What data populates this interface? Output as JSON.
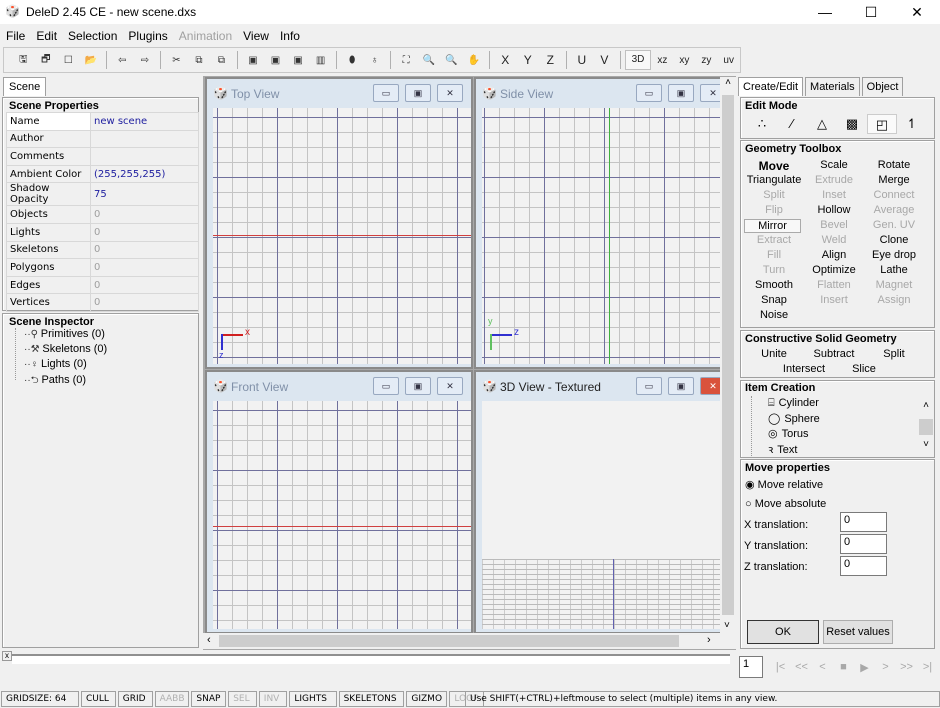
{
  "window": {
    "title": "DeleD 2.45 CE - new scene.dxs",
    "minimize": "—",
    "maximize": "☐",
    "close": "✕"
  },
  "menu": [
    "File",
    "Edit",
    "Selection",
    "Plugins",
    "Animation",
    "View",
    "Info"
  ],
  "menu_disabled": [
    "Animation"
  ],
  "toolbar": {
    "icons": [
      "save-icon",
      "save-all-icon",
      "new-icon",
      "open-icon",
      "undo-icon",
      "redo-icon",
      "cut-icon",
      "copy-icon",
      "paste-icon",
      "view1-icon",
      "view2-icon",
      "view3-icon",
      "view4-icon",
      "light-icon",
      "bulb-icon",
      "zoom-extents-icon",
      "zoom-out-icon",
      "zoom-in-icon",
      "pan-icon"
    ],
    "glyphs": [
      "🖫",
      "🗗",
      "☐",
      "📂",
      "⇦",
      "⇨",
      "✂",
      "⧉",
      "⧉",
      "▣",
      "▣",
      "▣",
      "▥",
      "⬮",
      "♁",
      "⛶",
      "🔍",
      "🔍",
      "✋"
    ],
    "axes": [
      "X",
      "Y",
      "Z",
      "U",
      "V"
    ],
    "views": [
      "3D",
      "xz",
      "xy",
      "zy",
      "uv"
    ],
    "active_view": "3D"
  },
  "left": {
    "tab": "Scene",
    "properties": {
      "title": "Scene Properties",
      "rows": [
        {
          "label": "Name",
          "value": "new scene"
        },
        {
          "label": "Author",
          "value": ""
        },
        {
          "label": "Comments",
          "value": ""
        },
        {
          "label": "Ambient Color",
          "value": "(255,255,255)"
        },
        {
          "label": "Shadow Opacity",
          "value": "75"
        },
        {
          "label": "Objects",
          "value": "0"
        },
        {
          "label": "Lights",
          "value": "0"
        },
        {
          "label": "Skeletons",
          "value": "0"
        },
        {
          "label": "Polygons",
          "value": "0"
        },
        {
          "label": "Edges",
          "value": "0"
        },
        {
          "label": "Vertices",
          "value": "0"
        }
      ]
    },
    "inspector": {
      "title": "Scene Inspector",
      "items": [
        "Primitives (0)",
        "Skeletons (0)",
        "Lights (0)",
        "Paths (0)"
      ]
    }
  },
  "views": [
    {
      "title": "Top View",
      "axis_h": "x",
      "axis_v": "z"
    },
    {
      "title": "Side View",
      "axis_h": "z",
      "axis_v": "y"
    },
    {
      "title": "Front View"
    },
    {
      "title": "3D View - Textured"
    }
  ],
  "right": {
    "tabs": [
      "Create/Edit",
      "Materials",
      "Object"
    ],
    "active_tab": "Create/Edit",
    "edit_mode": {
      "title": "Edit Mode",
      "icons": [
        "vertex-mode-icon",
        "edge-mode-icon",
        "polygon-mode-icon",
        "texture-mode-icon",
        "object-mode-icon",
        "skeleton-mode-icon"
      ],
      "glyphs": [
        "∴",
        "⁄",
        "△",
        "▩",
        "◰",
        "↿"
      ],
      "active": "object-mode-icon"
    },
    "geometry": {
      "title": "Geometry Toolbox",
      "tools": [
        {
          "l": "Move",
          "s": "b"
        },
        {
          "l": "Scale",
          "s": ""
        },
        {
          "l": "Rotate",
          "s": ""
        },
        {
          "l": "Triangulate",
          "s": ""
        },
        {
          "l": "Extrude",
          "s": "d"
        },
        {
          "l": "Merge",
          "s": ""
        },
        {
          "l": "Split",
          "s": "d"
        },
        {
          "l": "Inset",
          "s": "d"
        },
        {
          "l": "Connect",
          "s": "d"
        },
        {
          "l": "Flip",
          "s": "d"
        },
        {
          "l": "Hollow",
          "s": ""
        },
        {
          "l": "Average",
          "s": "d"
        },
        {
          "l": "Mirror",
          "s": "m"
        },
        {
          "l": "Bevel",
          "s": "d"
        },
        {
          "l": "Gen. UV",
          "s": "d"
        },
        {
          "l": "Extract",
          "s": "d"
        },
        {
          "l": "Weld",
          "s": "d"
        },
        {
          "l": "Clone",
          "s": ""
        },
        {
          "l": "Fill",
          "s": "d"
        },
        {
          "l": "Align",
          "s": ""
        },
        {
          "l": "Eye drop",
          "s": ""
        },
        {
          "l": "Turn",
          "s": "d"
        },
        {
          "l": "Optimize",
          "s": ""
        },
        {
          "l": "Lathe",
          "s": ""
        },
        {
          "l": "Smooth",
          "s": ""
        },
        {
          "l": "Flatten",
          "s": "d"
        },
        {
          "l": "Magnet",
          "s": "d"
        },
        {
          "l": "Snap",
          "s": ""
        },
        {
          "l": "Insert",
          "s": "d"
        },
        {
          "l": "Assign",
          "s": "d"
        },
        {
          "l": "Noise",
          "s": ""
        }
      ]
    },
    "csg": {
      "title": "Constructive Solid Geometry",
      "tools": [
        "Unite",
        "Subtract",
        "Split",
        "Intersect",
        "Slice"
      ]
    },
    "item_creation": {
      "title": "Item Creation",
      "items": [
        {
          "label": "Cylinder",
          "glyph": "⌸"
        },
        {
          "label": "Sphere",
          "glyph": "◯"
        },
        {
          "label": "Torus",
          "glyph": "◎"
        },
        {
          "label": "Text",
          "glyph": "ꝛ"
        }
      ]
    },
    "move": {
      "title": "Move properties",
      "relative": "Move relative",
      "absolute": "Move absolute",
      "selected": "relative",
      "fields": [
        {
          "label": "X translation:",
          "value": "0"
        },
        {
          "label": "Y translation:",
          "value": "0"
        },
        {
          "label": "Z translation:",
          "value": "0"
        }
      ],
      "ok": "OK",
      "reset": "Reset values"
    }
  },
  "timeline": {
    "frame": "1",
    "controls": [
      "|<",
      "<<",
      "<",
      "■",
      "▶",
      ">",
      ">>",
      ">|"
    ]
  },
  "status": {
    "gridsize": "GRIDSIZE: 64",
    "toggles": [
      {
        "l": "CULL",
        "on": true
      },
      {
        "l": "GRID",
        "on": true
      },
      {
        "l": "AABB",
        "on": false
      },
      {
        "l": "SNAP",
        "on": true
      },
      {
        "l": "SEL",
        "on": false
      },
      {
        "l": "INV",
        "on": false
      },
      {
        "l": "LIGHTS",
        "on": true
      },
      {
        "l": "SKELETONS",
        "on": true
      },
      {
        "l": "GIZMO",
        "on": true
      },
      {
        "l": "LOOP",
        "on": false
      }
    ],
    "message": "Use SHIFT(+CTRL)+leftmouse to select (multiple) items in any view."
  }
}
